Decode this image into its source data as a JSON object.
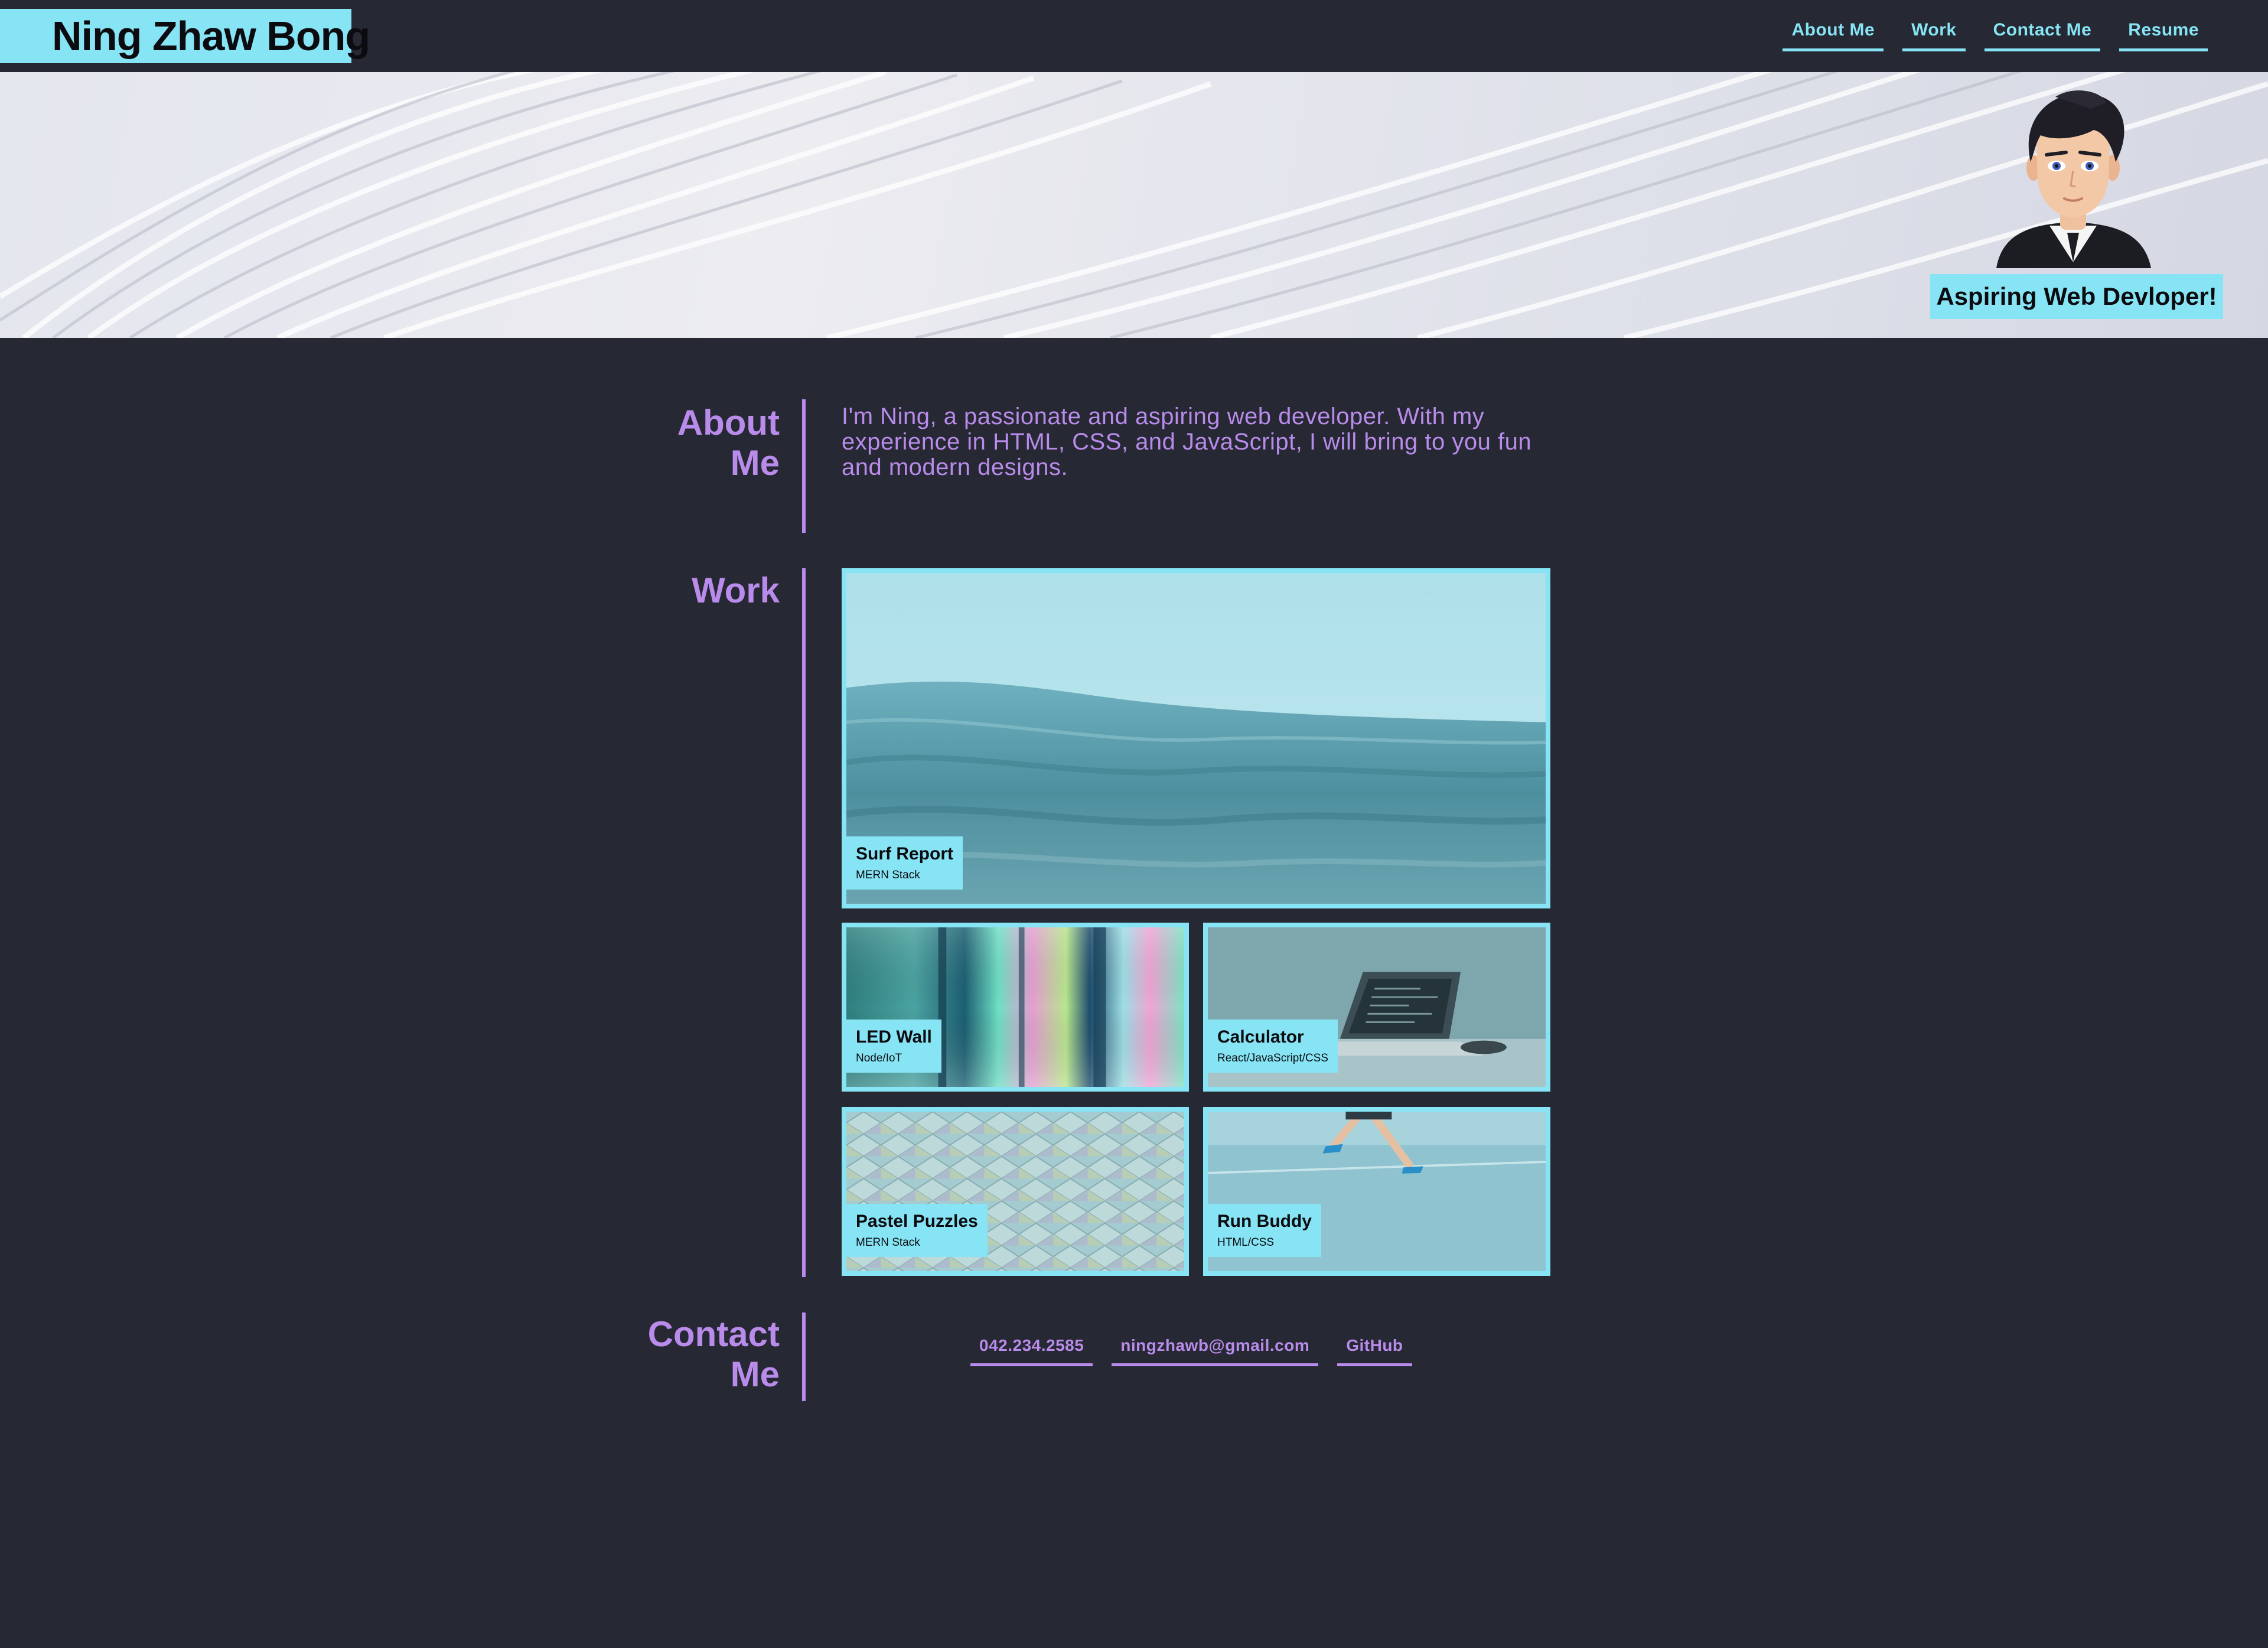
{
  "header": {
    "name": "Ning Zhaw Bong",
    "nav": [
      {
        "label": "About Me"
      },
      {
        "label": "Work"
      },
      {
        "label": "Contact Me"
      },
      {
        "label": "Resume"
      }
    ]
  },
  "hero": {
    "tagline": "Aspiring Web Devloper!"
  },
  "about": {
    "title_line1": "About",
    "title_line2": "Me",
    "text": "I'm Ning, a passionate and aspiring web developer. With my experience in HTML, CSS, and JavaScript, I will bring to you fun and modern designs."
  },
  "work": {
    "title": "Work",
    "projects": [
      {
        "title": "Surf Report",
        "stack": "MERN Stack"
      },
      {
        "title": "LED Wall",
        "stack": "Node/IoT"
      },
      {
        "title": "Calculator",
        "stack": "React/JavaScript/CSS"
      },
      {
        "title": "Pastel Puzzles",
        "stack": "MERN Stack"
      },
      {
        "title": "Run Buddy",
        "stack": "HTML/CSS"
      }
    ]
  },
  "contact": {
    "title_line1": "Contact",
    "title_line2": "Me",
    "links": [
      {
        "label": "042.234.2585"
      },
      {
        "label": "ningzhawb@gmail.com"
      },
      {
        "label": "GitHub"
      }
    ]
  },
  "colors": {
    "background": "#262833",
    "accent_cyan": "#86e4f4",
    "accent_purple": "#b98bea"
  },
  "icons": [
    "avatar-illustration"
  ]
}
